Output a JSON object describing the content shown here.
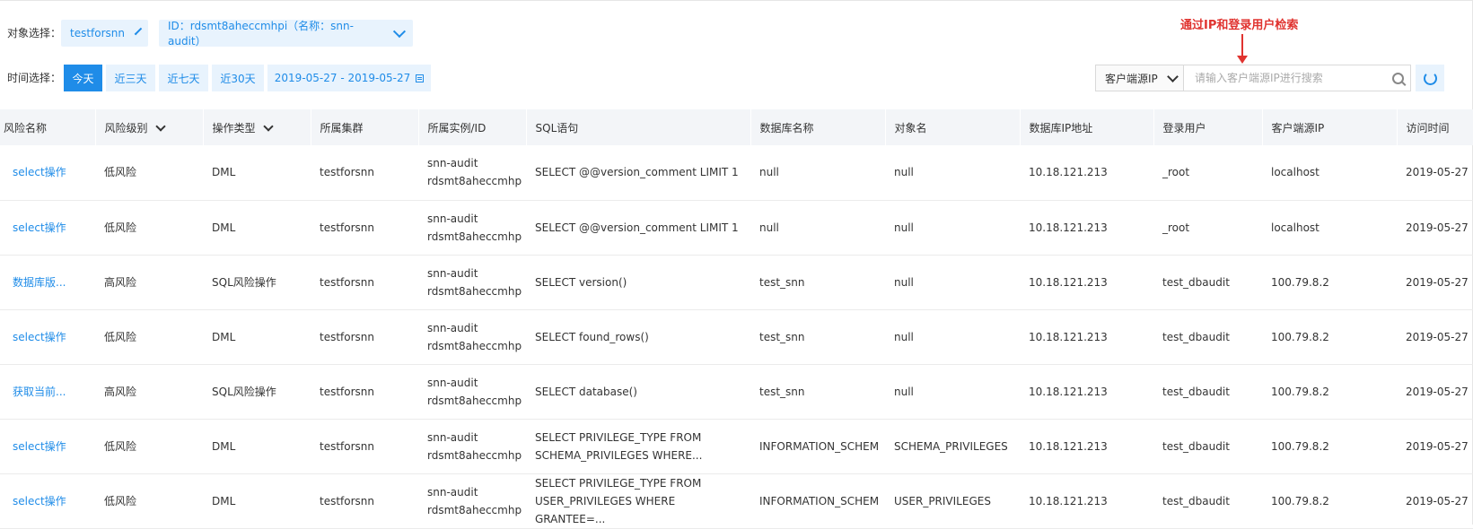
{
  "filters": {
    "object_label": "对象选择：",
    "object_value": "testforsnn",
    "instance_value": "ID：rdsmt8aheccmhpi（名称：snn-audit）",
    "time_label": "时间选择：",
    "time_tabs": [
      "今天",
      "近三天",
      "近七天",
      "近30天"
    ],
    "active_time_tab": "今天",
    "date_range": "2019-05-27 - 2019-05-27"
  },
  "annotation": "通过IP和登录用户检索",
  "search": {
    "field_select": "客户端源IP",
    "placeholder": "请输入客户端源IP进行搜索"
  },
  "accent_color": "#1f8ce8",
  "annotation_color": "#e0332f",
  "table": {
    "headers": [
      "风险名称",
      "风险级别",
      "操作类型",
      "所属集群",
      "所属实例/ID",
      "SQL语句",
      "数据库名称",
      "对象名",
      "数据库IP地址",
      "登录用户",
      "客户端源IP",
      "访问时间"
    ],
    "rows": [
      {
        "risk": "select操作",
        "level": "低风险",
        "op": "DML",
        "cluster": "testforsnn",
        "inst1": "snn-audit",
        "inst2": "rdsmt8aheccmhp",
        "sql1": "SELECT @@version_comment LIMIT 1",
        "sql2": "",
        "db": "null",
        "obj": "null",
        "dbip": "10.18.121.213",
        "user": "_root",
        "client": "localhost",
        "time": "2019-05-27"
      },
      {
        "risk": "select操作",
        "level": "低风险",
        "op": "DML",
        "cluster": "testforsnn",
        "inst1": "snn-audit",
        "inst2": "rdsmt8aheccmhp",
        "sql1": "SELECT @@version_comment LIMIT 1",
        "sql2": "",
        "db": "null",
        "obj": "null",
        "dbip": "10.18.121.213",
        "user": "_root",
        "client": "localhost",
        "time": "2019-05-27"
      },
      {
        "risk": "数据库版...",
        "level": "高风险",
        "op": "SQL风险操作",
        "cluster": "testforsnn",
        "inst1": "snn-audit",
        "inst2": "rdsmt8aheccmhp",
        "sql1": "SELECT version()",
        "sql2": "",
        "db": "test_snn",
        "obj": "null",
        "dbip": "10.18.121.213",
        "user": "test_dbaudit",
        "client": "100.79.8.2",
        "time": "2019-05-27"
      },
      {
        "risk": "select操作",
        "level": "低风险",
        "op": "DML",
        "cluster": "testforsnn",
        "inst1": "snn-audit",
        "inst2": "rdsmt8aheccmhp",
        "sql1": "SELECT found_rows()",
        "sql2": "",
        "db": "test_snn",
        "obj": "null",
        "dbip": "10.18.121.213",
        "user": "test_dbaudit",
        "client": "100.79.8.2",
        "time": "2019-05-27"
      },
      {
        "risk": "获取当前...",
        "level": "高风险",
        "op": "SQL风险操作",
        "cluster": "testforsnn",
        "inst1": "snn-audit",
        "inst2": "rdsmt8aheccmhp",
        "sql1": "SELECT database()",
        "sql2": "",
        "db": "test_snn",
        "obj": "null",
        "dbip": "10.18.121.213",
        "user": "test_dbaudit",
        "client": "100.79.8.2",
        "time": "2019-05-27"
      },
      {
        "risk": "select操作",
        "level": "低风险",
        "op": "DML",
        "cluster": "testforsnn",
        "inst1": "snn-audit",
        "inst2": "rdsmt8aheccmhp",
        "sql1": "SELECT PRIVILEGE_TYPE FROM",
        "sql2": "SCHEMA_PRIVILEGES WHERE...",
        "db": "INFORMATION_SCHEM",
        "obj": "SCHEMA_PRIVILEGES",
        "dbip": "10.18.121.213",
        "user": "test_dbaudit",
        "client": "100.79.8.2",
        "time": "2019-05-27"
      },
      {
        "risk": "select操作",
        "level": "低风险",
        "op": "DML",
        "cluster": "testforsnn",
        "inst1": "snn-audit",
        "inst2": "rdsmt8aheccmhp",
        "sql1": "SELECT PRIVILEGE_TYPE FROM",
        "sql2": "USER_PRIVILEGES WHERE GRANTEE=...",
        "db": "INFORMATION_SCHEM",
        "obj": "USER_PRIVILEGES",
        "dbip": "10.18.121.213",
        "user": "test_dbaudit",
        "client": "100.79.8.2",
        "time": "2019-05-27"
      }
    ]
  }
}
